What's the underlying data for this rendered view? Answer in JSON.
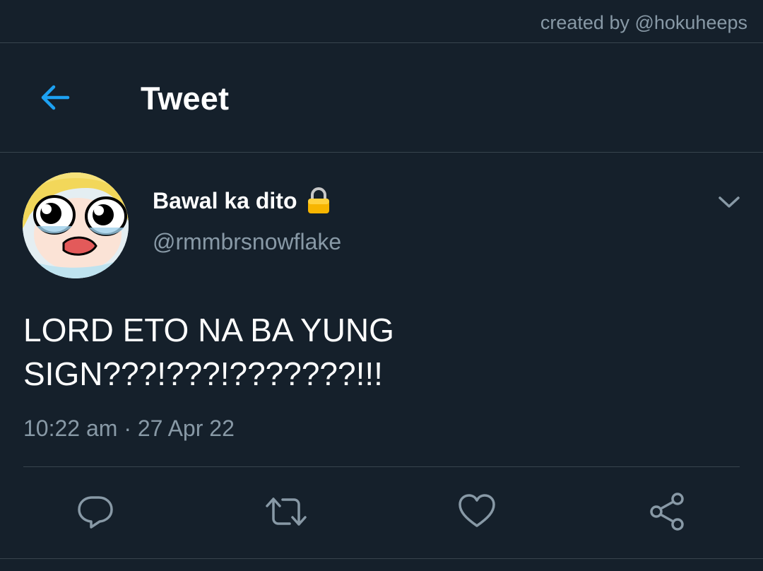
{
  "watermark": "created by @hokuheeps",
  "header": {
    "title": "Tweet",
    "back_icon": "arrow-left-icon",
    "accent_color": "#1da1f2"
  },
  "tweet": {
    "author": {
      "display_name": "Bawal ka dito",
      "handle": "@rmmbrsnowflake",
      "protected_icon": "lock-icon"
    },
    "text": "LORD ETO NA BA YUNG SIGN???!???!???????!!!",
    "timestamp": "10:22 am · 27 Apr 22"
  },
  "actions": [
    {
      "name": "reply",
      "icon": "reply-icon"
    },
    {
      "name": "retweet",
      "icon": "retweet-icon"
    },
    {
      "name": "like",
      "icon": "heart-icon"
    },
    {
      "name": "share",
      "icon": "share-icon"
    }
  ],
  "colors": {
    "background": "#15202b",
    "secondary_text": "#8899a6",
    "divider": "#38444d"
  }
}
